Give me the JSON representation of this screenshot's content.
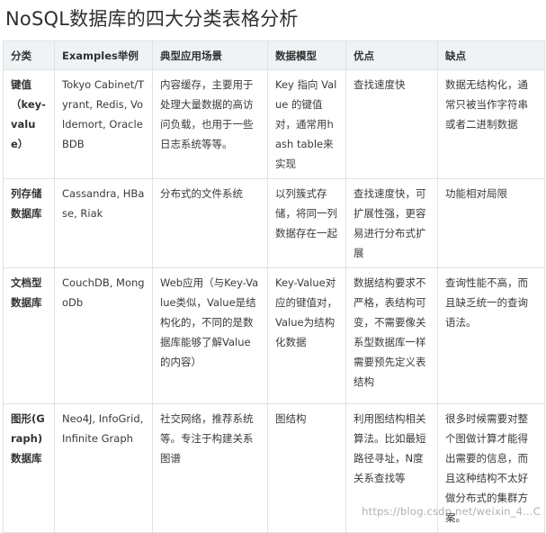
{
  "title": "NoSQL数据库的四大分类表格分析",
  "table": {
    "headers": [
      "分类",
      "Examples举例",
      "典型应用场景",
      "数据模型",
      "优点",
      "缺点"
    ],
    "rows": [
      [
        "键值（key-value）",
        "Tokyo Cabinet/Tyrant, Redis, Voldemort, Oracle BDB",
        "内容缓存，主要用于处理大量数据的高访问负载，也用于一些日志系统等等。",
        "Key 指向 Value 的键值对，通常用hash table来实现",
        "查找速度快",
        "数据无结构化，通常只被当作字符串或者二进制数据"
      ],
      [
        "列存储数据库",
        "Cassandra, HBase, Riak",
        "分布式的文件系统",
        "以列簇式存储，将同一列数据存在一起",
        "查找速度快，可扩展性强，更容易进行分布式扩展",
        "功能相对局限"
      ],
      [
        "文档型数据库",
        "CouchDB, MongoDb",
        "Web应用（与Key-Value类似，Value是结构化的，不同的是数据库能够了解Value的内容）",
        "Key-Value对应的键值对，Value为结构化数据",
        "数据结构要求不严格，表结构可变，不需要像关系型数据库一样需要预先定义表结构",
        "查询性能不高，而且缺乏统一的查询语法。"
      ],
      [
        "图形(Graph)数据库",
        "Neo4J, InfoGrid, Infinite Graph",
        "社交网络，推荐系统等。专注于构建关系图谱",
        "图结构",
        "利用图结构相关算法。比如最短路径寻址，N度关系查找等",
        "很多时候需要对整个图做计算才能得出需要的信息，而且这种结构不太好做分布式的集群方案。"
      ]
    ]
  },
  "watermark": "https://blog.csdn.net/weixin_4...C"
}
